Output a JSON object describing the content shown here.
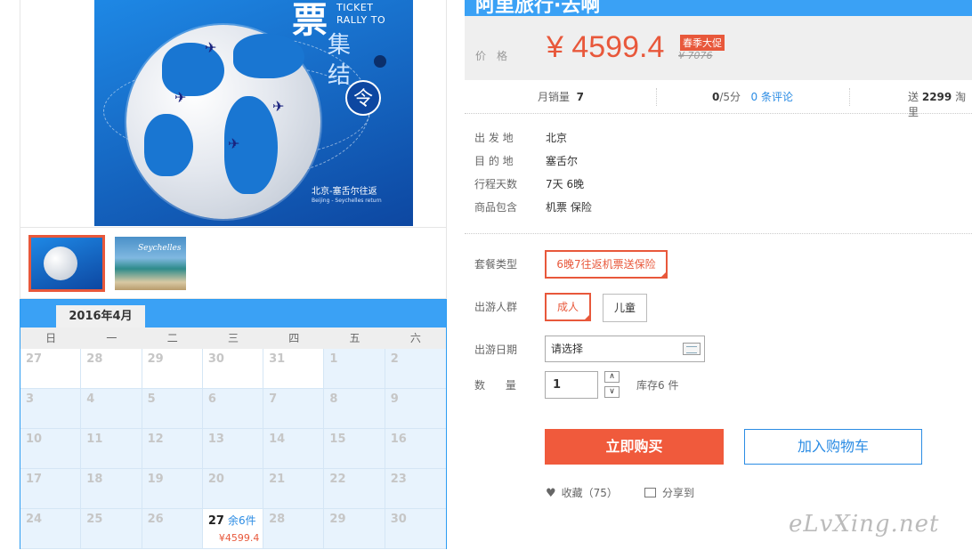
{
  "main_image": {
    "title_big": "票",
    "ticket_line1": "TICKET",
    "ticket_line2": "RALLY TO",
    "jiji": "集\n结",
    "ling": "令",
    "route_cn": "北京-塞舌尔往返",
    "route_en": "Beijing - Seychelles return"
  },
  "thumbnails": [
    {
      "name": "globe-ticket"
    },
    {
      "name": "seychelles-beach",
      "text": "Seychelles"
    }
  ],
  "calendar": {
    "month": "2016年4月",
    "weekdays": [
      "日",
      "一",
      "二",
      "三",
      "四",
      "五",
      "六"
    ],
    "cells": [
      {
        "day": "27"
      },
      {
        "day": "28"
      },
      {
        "day": "29"
      },
      {
        "day": "30"
      },
      {
        "day": "31"
      },
      {
        "day": "1"
      },
      {
        "day": "2"
      },
      {
        "day": "3"
      },
      {
        "day": "4"
      },
      {
        "day": "5"
      },
      {
        "day": "6"
      },
      {
        "day": "7"
      },
      {
        "day": "8"
      },
      {
        "day": "9"
      },
      {
        "day": "10"
      },
      {
        "day": "11"
      },
      {
        "day": "12"
      },
      {
        "day": "13"
      },
      {
        "day": "14"
      },
      {
        "day": "15"
      },
      {
        "day": "16"
      },
      {
        "day": "17"
      },
      {
        "day": "18"
      },
      {
        "day": "19"
      },
      {
        "day": "20"
      },
      {
        "day": "21"
      },
      {
        "day": "22"
      },
      {
        "day": "23"
      },
      {
        "day": "24"
      },
      {
        "day": "25"
      },
      {
        "day": "26"
      },
      {
        "day": "27",
        "remain": "余6件",
        "price": "¥4599.4"
      },
      {
        "day": "28"
      },
      {
        "day": "29"
      },
      {
        "day": "30"
      }
    ]
  },
  "product": {
    "title": "阿里旅行·去啊",
    "price_label": "价格",
    "price": "¥ 4599.4",
    "promo_tag": "春季大促",
    "old_price": "¥ 7076"
  },
  "stats": {
    "monthly_sales_label": "月销量",
    "monthly_sales": "7",
    "rating": "0",
    "rating_suffix": "/5分",
    "reviews": "0 条评论",
    "points_prefix": "送",
    "points": "2299",
    "points_suffix": "淘里"
  },
  "info": [
    {
      "key": "出 发 地",
      "value": "北京"
    },
    {
      "key": "目 的 地",
      "value": "塞舌尔"
    },
    {
      "key": "行程天数",
      "value": "7天 6晚"
    },
    {
      "key": "商品包含",
      "value": "机票  保险"
    }
  ],
  "options": {
    "package_label": "套餐类型",
    "package_value": "6晚7往返机票送保险",
    "traveler_label": "出游人群",
    "traveler_adult": "成人",
    "traveler_child": "儿童",
    "date_label": "出游日期",
    "date_placeholder": "请选择",
    "qty_label": "数      量",
    "qty_value": "1",
    "stock": "库存6 件"
  },
  "actions": {
    "buy": "立即购买",
    "cart": "加入购物车",
    "favorite": "收藏（75）",
    "share": "分享到"
  },
  "watermark": "eLvXing.net"
}
